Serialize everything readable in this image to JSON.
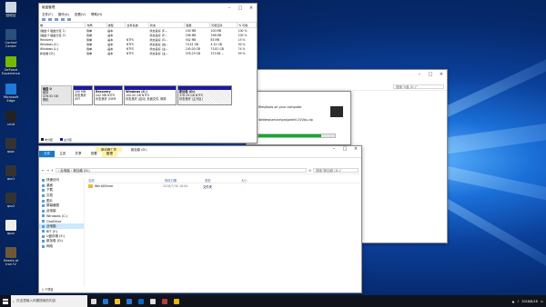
{
  "desktop": {
    "icons": [
      {
        "label": "回收站",
        "color": "#cfd8e3"
      },
      {
        "label": "Control Center",
        "color": "#2a4f7a"
      },
      {
        "label": "GeForce Experience",
        "color": "#76b900"
      },
      {
        "label": "Microsoft Edge",
        "color": "#1d7ad6"
      },
      {
        "label": "cmd",
        "color": "#222"
      },
      {
        "label": "qsoc",
        "color": "#333"
      },
      {
        "label": "qsv1",
        "color": "#333"
      },
      {
        "label": "qsv2",
        "color": "#333"
      },
      {
        "label": "qsvn",
        "color": "#eee"
      },
      {
        "label": "Hearts of Iron IV",
        "color": "#6e5836"
      }
    ]
  },
  "disk_mgmt": {
    "title": "磁盘管理",
    "menu": [
      "文件(F)",
      "操作(A)",
      "查看(V)",
      "帮助(H)"
    ],
    "columns": [
      "卷",
      "布局",
      "类型",
      "文件系统",
      "状态",
      "容量",
      "可用空间",
      "% 可用"
    ],
    "rows": [
      [
        "(磁盘 0 磁盘分区 1)",
        "简单",
        "基本",
        "",
        "状态良好 (E...",
        "100 MB",
        "100 MB",
        "100 %"
      ],
      [
        "(磁盘 0 磁盘分区 2)",
        "简单",
        "基本",
        "",
        "状态良好 (E...",
        "298 MB",
        "298 MB",
        "100 %"
      ],
      [
        "Recovery",
        "简单",
        "基本",
        "NTFS",
        "状态良好 (O...",
        "542 MB",
        "83 MB",
        "15 %"
      ],
      [
        "Windows (C:)",
        "简单",
        "基本",
        "NTFS",
        "状态良好 (启...",
        "74.41 GB",
        "4.31 GB",
        "30 %"
      ],
      [
        "Windows (L:)",
        "简单",
        "基本",
        "NTFS",
        "状态良好 (主...",
        "100.00 GB",
        "73.81 GB",
        "74 %"
      ],
      [
        "新加卷 (D:)",
        "简单",
        "基本",
        "NTFS",
        "状态良好 (主...",
        "376.29 GB",
        "372.66 ...",
        "99 %"
      ]
    ],
    "disk": {
      "name": "磁盘 0",
      "type": "基本",
      "size": "476.92 GB",
      "status": "联机"
    },
    "partitions": [
      {
        "name": "",
        "size": "100 MB",
        "status": "状态良好 (EFI"
      },
      {
        "name": "Recovery",
        "size": "542 MB NTFS",
        "status": "状态良好 (OEM"
      },
      {
        "name": "Windows (C:)",
        "size": "100.00 GB NTFS",
        "status": "状态良好 (启动, 页面文件, 故障"
      },
      {
        "name": "新加卷 (D:)",
        "size": "376.29 GB NTFS",
        "status": "状态良好 (主分区)"
      }
    ],
    "legend": [
      "未分配",
      "主分区"
    ]
  },
  "progress_dialog": {
    "text": "files/tools on your computer",
    "path": "dwidew\\service\\pro\\pedriil-CVVjsu.zip",
    "progress": 0.82
  },
  "back_explorer": {
    "search_placeholder": "搜索\"U盘 (E:)\""
  },
  "explorer": {
    "ribbon_tabs": [
      "文件",
      "主页",
      "共享",
      "查看",
      "管理"
    ],
    "manage_context": "驱动器工具",
    "title": "新加卷 (D:)",
    "address": "› 此电脑 › 新加卷 (D:)",
    "search_placeholder": "搜索\"新加卷 (D:)\"",
    "nav": [
      "快速访问",
      "桌面",
      "下载",
      "文档",
      "图片",
      "屏幕截图",
      "此电脑",
      "Windows (C:)",
      "OneDrive",
      "此电脑",
      "BIT (F:)",
      "U盘存储 (E:)",
      "新加卷 (D:)",
      "网络"
    ],
    "columns": [
      "名称",
      "修改日期",
      "类型",
      "大小"
    ],
    "files": [
      {
        "name": "Win10Driver",
        "date": "2018/7/30 18:00",
        "type": "文件夹"
      }
    ],
    "status": "1 个项目"
  },
  "taskbar": {
    "search_placeholder": "在这里输入你要搜索的内容",
    "apps": [
      {
        "name": "task-view-icon",
        "color": "#ddd"
      },
      {
        "name": "edge-icon",
        "color": "#1d7ad6"
      },
      {
        "name": "explorer-icon",
        "color": "#f2c12e"
      },
      {
        "name": "store-icon",
        "color": "#2e7bd6"
      },
      {
        "name": "mail-icon",
        "color": "#0a64c8"
      },
      {
        "name": "app-icon",
        "color": "#e0e0e0"
      },
      {
        "name": "app2-icon",
        "color": "#b63b3b"
      },
      {
        "name": "app3-icon",
        "color": "#e6b800"
      }
    ],
    "date": "2018/8/18"
  }
}
